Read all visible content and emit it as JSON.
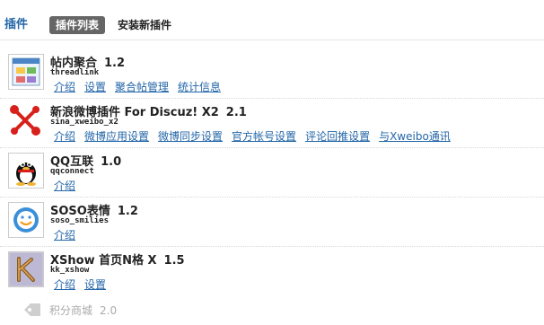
{
  "header": {
    "title": "插件",
    "tab_active": "插件列表",
    "tab_install": "安装新插件"
  },
  "plugins": [
    {
      "icon": "threadlink-icon",
      "name": "帖内聚合",
      "version": "1.2",
      "ident": "threadlink",
      "links": [
        "介绍",
        "设置",
        "聚合帖管理",
        "统计信息"
      ]
    },
    {
      "icon": "sina-weibo-icon",
      "name": "新浪微博插件  For Discuz! X2",
      "version": "2.1",
      "ident": "sina_xweibo_x2",
      "links": [
        "介绍",
        "微博应用设置",
        "微博同步设置",
        "官方帐号设置",
        "评论回推设置",
        "与Xweibo通讯"
      ]
    },
    {
      "icon": "qq-penguin-icon",
      "name": "QQ互联",
      "version": "1.0",
      "ident": "qqconnect",
      "links": [
        "介绍"
      ]
    },
    {
      "icon": "soso-smilies-icon",
      "name": "SOSO表情",
      "version": "1.2",
      "ident": "soso_smilies",
      "links": [
        "介绍"
      ]
    },
    {
      "icon": "xshow-k-icon",
      "name": "XShow 首页N格  X",
      "version": "1.5",
      "ident": "kk_xshow",
      "links": [
        "介绍",
        "设置"
      ]
    }
  ],
  "disabled_plugin": {
    "icon": "shop-tag-icon",
    "name": "积分商城",
    "version": "2.0"
  }
}
